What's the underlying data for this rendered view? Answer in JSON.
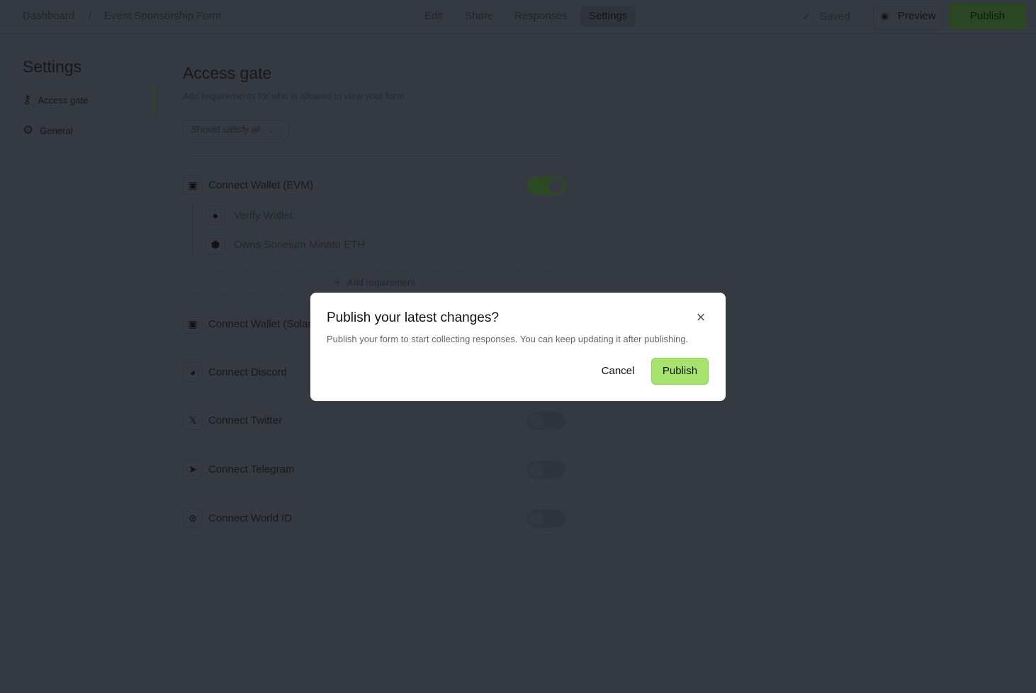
{
  "header": {
    "breadcrumb": [
      "Dashboard",
      "/",
      "Event Sponsorship Form"
    ],
    "tabs": [
      "Edit",
      "Share",
      "Responses",
      "Settings"
    ],
    "active_tab": "Settings",
    "saved": "Saved",
    "preview": "Preview",
    "publish": "Publish"
  },
  "sidebar": {
    "title": "Settings",
    "items": [
      {
        "label": "Access gate",
        "icon": "key-icon",
        "active": true
      },
      {
        "label": "General",
        "icon": "gear-icon"
      }
    ]
  },
  "main": {
    "title": "Access gate",
    "subtitle": "Add requirements for who is allowed to view your form",
    "select": "Should satisfy all",
    "requirements": [
      {
        "label": "Connect Wallet (EVM)",
        "on": true
      },
      {
        "label": "Connect Wallet (Solana)",
        "on": false
      },
      {
        "label": "Connect Discord",
        "on": false
      },
      {
        "label": "Connect Twitter",
        "on": false
      },
      {
        "label": "Connect Telegram",
        "on": false
      },
      {
        "label": "Connect World ID",
        "on": false
      }
    ],
    "sub_items": [
      "Verify Wallet",
      "Owns Soneium Minato ETH"
    ],
    "add_requirement": "Add requirement"
  },
  "dialog": {
    "title": "Publish your latest changes?",
    "body": "Publish your form to start collecting responses. You can keep updating it after publishing.",
    "cancel": "Cancel",
    "publish": "Publish"
  },
  "colors": {
    "accent": "#a5e36c",
    "overlay": "#353941"
  }
}
